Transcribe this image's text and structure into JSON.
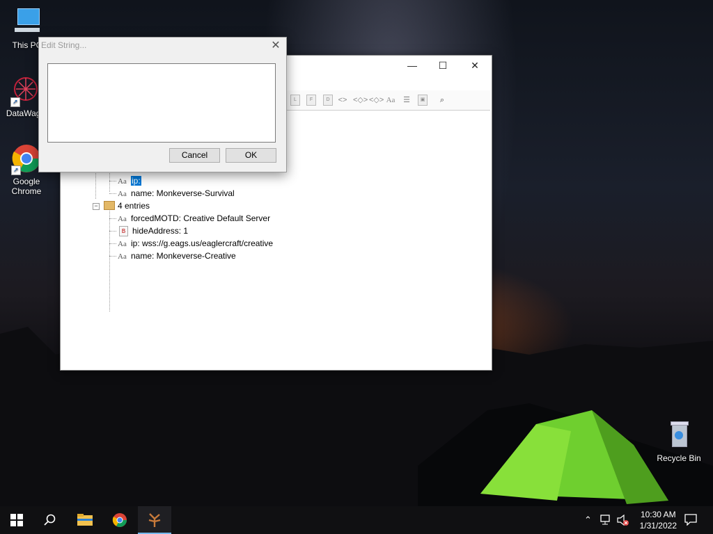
{
  "desktop": {
    "icons": [
      {
        "label": "This PC",
        "icon": "computer-icon"
      },
      {
        "label": "DataWago",
        "icon": "datawagon-icon"
      },
      {
        "label": "Google Chrome",
        "icon": "chrome-icon"
      },
      {
        "label": "Recycle Bin",
        "icon": "recycle-bin-icon"
      }
    ]
  },
  "main_window": {
    "controls": {
      "minimize": "—",
      "maximize": "☐",
      "close": "✕"
    },
    "tree": {
      "rows": [
        {
          "type": "string",
          "text": "ip:",
          "selected": true
        },
        {
          "type": "string",
          "text": "name: Monkeverse-Survival"
        },
        {
          "type": "compound",
          "text": "4 entries",
          "expander": "−"
        },
        {
          "type": "string",
          "text": "forcedMOTD: Creative Default Server"
        },
        {
          "type": "byte",
          "text": "hideAddress: 1",
          "badge": "B"
        },
        {
          "type": "string",
          "text": "ip: wss://g.eags.us/eaglercraft/creative"
        },
        {
          "type": "string",
          "text": "name: Monkeverse-Creative"
        }
      ],
      "type_glyph": "Aa"
    }
  },
  "dialog": {
    "title": "Edit String...",
    "close": "✕",
    "text_value": "",
    "cancel_label": "Cancel",
    "ok_label": "OK"
  },
  "taskbar": {
    "time": "10:30 AM",
    "date": "1/31/2022"
  },
  "colors": {
    "selection": "#0078d7",
    "taskbar": "#101012"
  }
}
